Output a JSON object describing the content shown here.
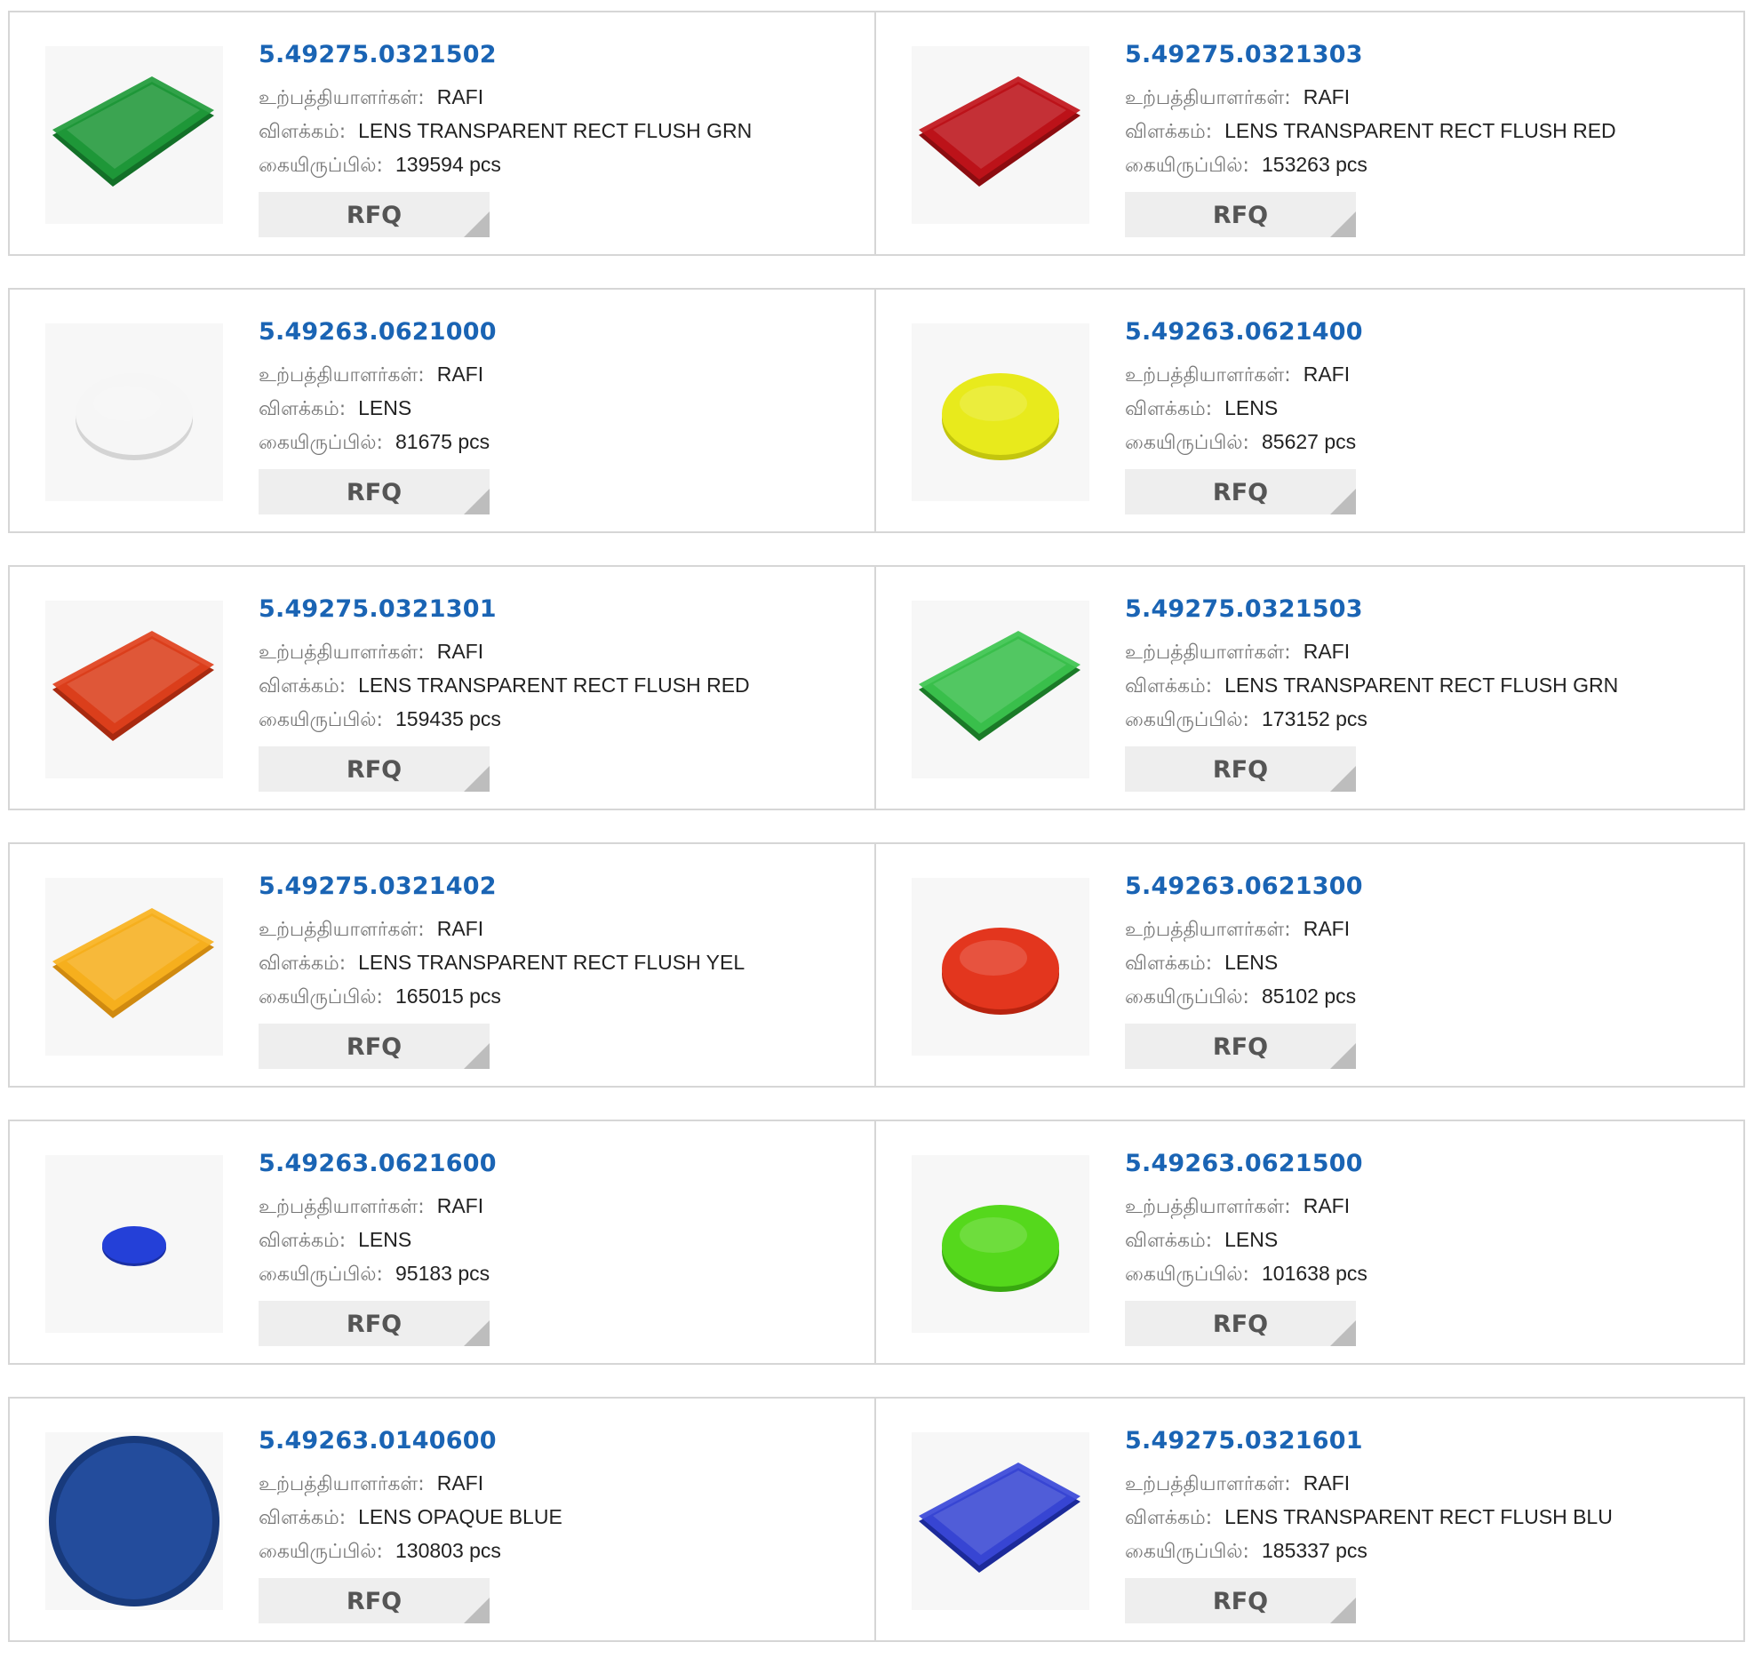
{
  "labels": {
    "manufacturer": "உற்பத்தியாளர்கள்:",
    "description": "விளக்கம்:",
    "stock": "கையிருப்பில்:",
    "rfq": "RFQ"
  },
  "products": [
    {
      "part": "5.49275.0321502",
      "manufacturer": "RAFI",
      "description": "LENS TRANSPARENT RECT FLUSH GRN",
      "stock": "139594 pcs",
      "shape": "rect",
      "color": "#1f9a3a",
      "edge": "#137028"
    },
    {
      "part": "5.49275.0321303",
      "manufacturer": "RAFI",
      "description": "LENS TRANSPARENT RECT FLUSH RED",
      "stock": "153263 pcs",
      "shape": "rect",
      "color": "#c0141a",
      "edge": "#8c0c10"
    },
    {
      "part": "5.49263.0621000",
      "manufacturer": "RAFI",
      "description": "LENS",
      "stock": "81675 pcs",
      "shape": "disc",
      "color": "#f6f6f6",
      "edge": "#d4d4d4"
    },
    {
      "part": "5.49263.0621400",
      "manufacturer": "RAFI",
      "description": "LENS",
      "stock": "85627 pcs",
      "shape": "disc",
      "color": "#e8ea1c",
      "edge": "#c3c50e"
    },
    {
      "part": "5.49275.0321301",
      "manufacturer": "RAFI",
      "description": "LENS TRANSPARENT RECT FLUSH RED",
      "stock": "159435 pcs",
      "shape": "rect",
      "color": "#e0401c",
      "edge": "#a82a10"
    },
    {
      "part": "5.49275.0321503",
      "manufacturer": "RAFI",
      "description": "LENS TRANSPARENT RECT FLUSH GRN",
      "stock": "173152 pcs",
      "shape": "rect",
      "color": "#3cc44e",
      "edge": "#1b7a28"
    },
    {
      "part": "5.49275.0321402",
      "manufacturer": "RAFI",
      "description": "LENS TRANSPARENT RECT FLUSH YEL",
      "stock": "165015 pcs",
      "shape": "rect",
      "color": "#f8b21e",
      "edge": "#d08a10"
    },
    {
      "part": "5.49263.0621300",
      "manufacturer": "RAFI",
      "description": "LENS",
      "stock": "85102 pcs",
      "shape": "disc",
      "color": "#e3361e",
      "edge": "#b8230f"
    },
    {
      "part": "5.49263.0621600",
      "manufacturer": "RAFI",
      "description": "LENS",
      "stock": "95183 pcs",
      "shape": "smalldisc",
      "color": "#2440d8",
      "edge": "#1a2fa4"
    },
    {
      "part": "5.49263.0621500",
      "manufacturer": "RAFI",
      "description": "LENS",
      "stock": "101638 pcs",
      "shape": "disc",
      "color": "#55d81c",
      "edge": "#38a810"
    },
    {
      "part": "5.49263.0140600",
      "manufacturer": "RAFI",
      "description": "LENS OPAQUE BLUE",
      "stock": "130803 pcs",
      "shape": "bigdisc",
      "color": "#234c9c",
      "edge": "#183a7c"
    },
    {
      "part": "5.49275.0321601",
      "manufacturer": "RAFI",
      "description": "LENS TRANSPARENT RECT FLUSH BLU",
      "stock": "185337 pcs",
      "shape": "rect",
      "color": "#3a48d8",
      "edge": "#1c2a9a"
    }
  ]
}
